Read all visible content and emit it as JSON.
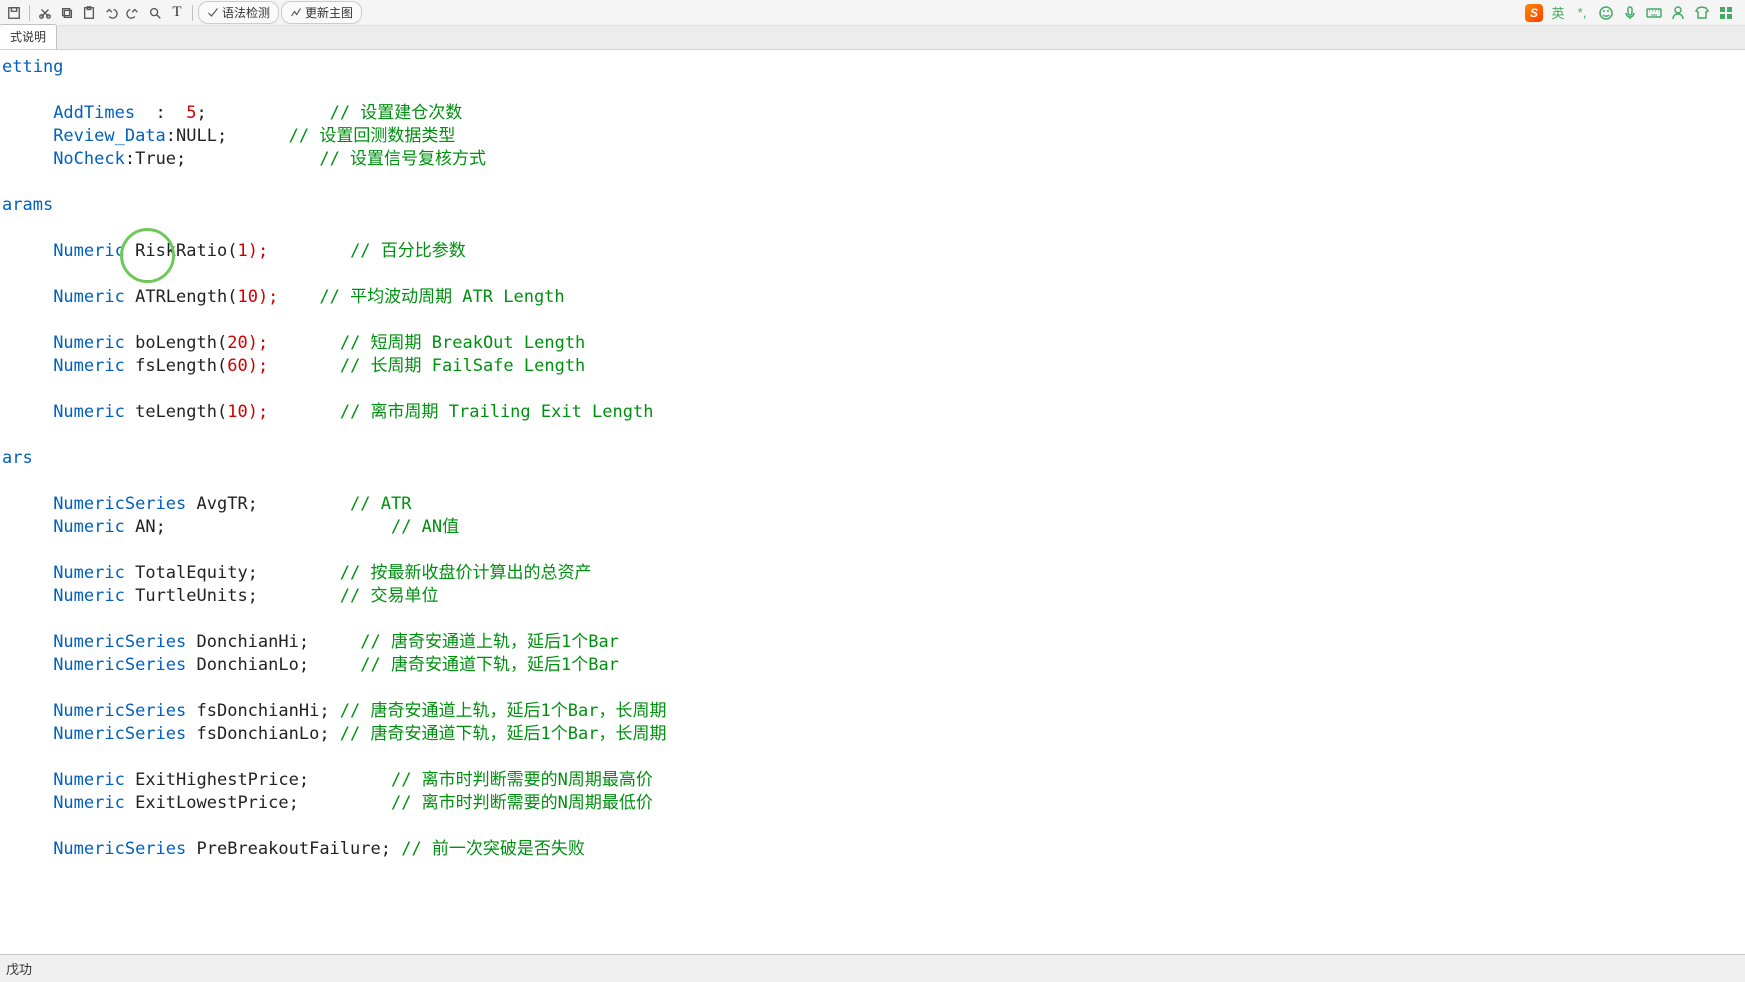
{
  "toolbar": {
    "syntax_check": "语法检测",
    "update_main_chart": "更新主图"
  },
  "right_bar": {
    "lang": "英"
  },
  "tabs": {
    "active": "式说明"
  },
  "code": {
    "sections": {
      "setting": "etting",
      "params": "arams",
      "vars": "ars"
    },
    "l_addtimes": {
      "kw": "AddTimes",
      "mid": "  :  ",
      "val": "5",
      "tail": ";            ",
      "cm": "// 设置建仓次数"
    },
    "l_reviewdata": {
      "kw": "Review_Data",
      "mid": ":",
      "val": "NULL",
      "tail": ";      ",
      "cm": "// 设置回测数据类型"
    },
    "l_nocheck": {
      "kw": "NoCheck",
      "mid": ":",
      "val": "True",
      "tail": ";             ",
      "cm": "// 设置信号复核方式"
    },
    "l_risk": {
      "type": "Numeric",
      "name": "RiskRatio(",
      "num": "1",
      "tail": ");        ",
      "cm": "// 百分比参数"
    },
    "l_atrlen": {
      "type": "Numeric",
      "name": "ATRLength(",
      "num": "10",
      "tail": ");    ",
      "cm": "// 平均波动周期 ATR Length"
    },
    "l_bolen": {
      "type": "Numeric",
      "name": "boLength(",
      "num": "20",
      "tail": ");       ",
      "cm": "// 短周期 BreakOut Length"
    },
    "l_fslen": {
      "type": "Numeric",
      "name": "fsLength(",
      "num": "60",
      "tail": ");       ",
      "cm": "// 长周期 FailSafe Length"
    },
    "l_telen": {
      "type": "Numeric",
      "name": "teLength(",
      "num": "10",
      "tail": ");       ",
      "cm": "// 离市周期 Trailing Exit Length"
    },
    "l_avgtr": {
      "type": "NumericSeries",
      "name": "AvgTR;         ",
      "cm": "// ATR"
    },
    "l_an": {
      "type": "Numeric",
      "name": "AN;                      ",
      "cm": "// AN值"
    },
    "l_te": {
      "type": "Numeric",
      "name": "TotalEquity;        ",
      "cm": "// 按最新收盘价计算出的总资产"
    },
    "l_tu": {
      "type": "Numeric",
      "name": "TurtleUnits;        ",
      "cm": "// 交易单位"
    },
    "l_dhi": {
      "type": "NumericSeries",
      "name": "DonchianHi;     ",
      "cm": "// 唐奇安通道上轨，延后1个Bar"
    },
    "l_dlo": {
      "type": "NumericSeries",
      "name": "DonchianLo;     ",
      "cm": "// 唐奇安通道下轨，延后1个Bar"
    },
    "l_fdhi": {
      "type": "NumericSeries",
      "name": "fsDonchianHi; ",
      "cm": "// 唐奇安通道上轨，延后1个Bar，长周期"
    },
    "l_fdlo": {
      "type": "NumericSeries",
      "name": "fsDonchianLo; ",
      "cm": "// 唐奇安通道下轨，延后1个Bar，长周期"
    },
    "l_ehp": {
      "type": "Numeric",
      "name": "ExitHighestPrice;        ",
      "cm": "// 离市时判断需要的N周期最高价"
    },
    "l_elp": {
      "type": "Numeric",
      "name": "ExitLowestPrice;         ",
      "cm": "// 离市时判断需要的N周期最低价"
    },
    "l_pbf": {
      "type": "NumericSeries",
      "name": "PreBreakoutFailure; ",
      "cm": "// 前一次突破是否失败"
    }
  },
  "status": {
    "text": "戊功"
  }
}
